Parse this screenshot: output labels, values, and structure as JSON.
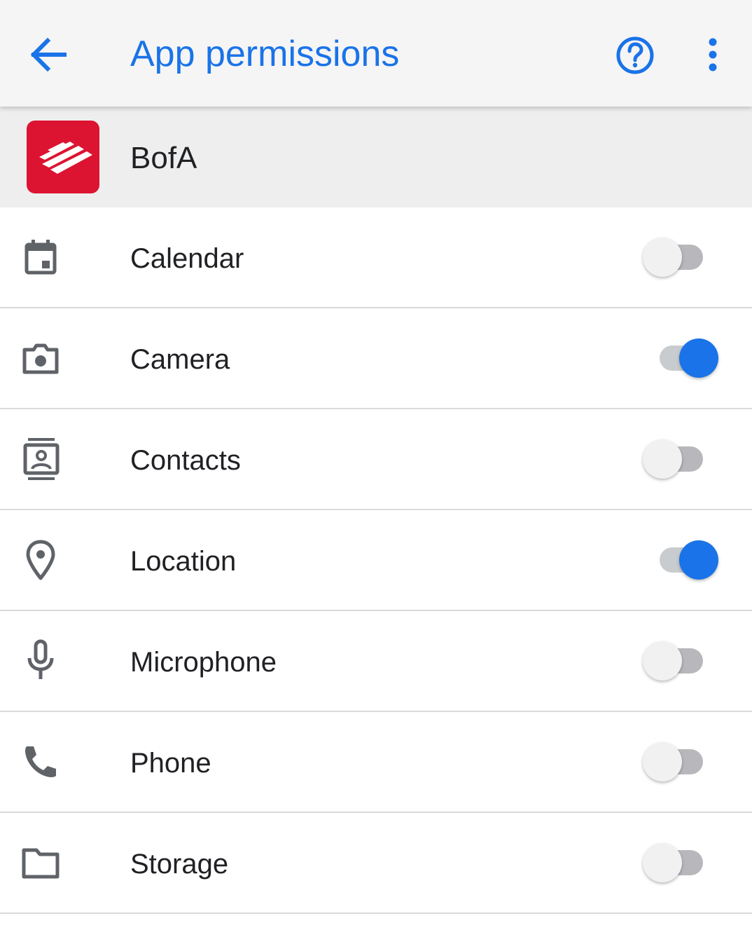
{
  "appbar": {
    "title": "App permissions",
    "back_icon": "arrow-back-icon",
    "help_icon": "help-circle-icon",
    "more_icon": "more-vert-icon",
    "accent_color": "#1a73e8"
  },
  "app": {
    "name": "BofA",
    "logo_icon": "bank-of-america-logo",
    "logo_color": "#dc1431"
  },
  "permissions": [
    {
      "label": "Calendar",
      "icon": "calendar-icon",
      "enabled": false
    },
    {
      "label": "Camera",
      "icon": "camera-icon",
      "enabled": true
    },
    {
      "label": "Contacts",
      "icon": "contacts-icon",
      "enabled": false
    },
    {
      "label": "Location",
      "icon": "location-pin-icon",
      "enabled": true
    },
    {
      "label": "Microphone",
      "icon": "microphone-icon",
      "enabled": false
    },
    {
      "label": "Phone",
      "icon": "phone-icon",
      "enabled": false
    },
    {
      "label": "Storage",
      "icon": "folder-icon",
      "enabled": false
    }
  ]
}
